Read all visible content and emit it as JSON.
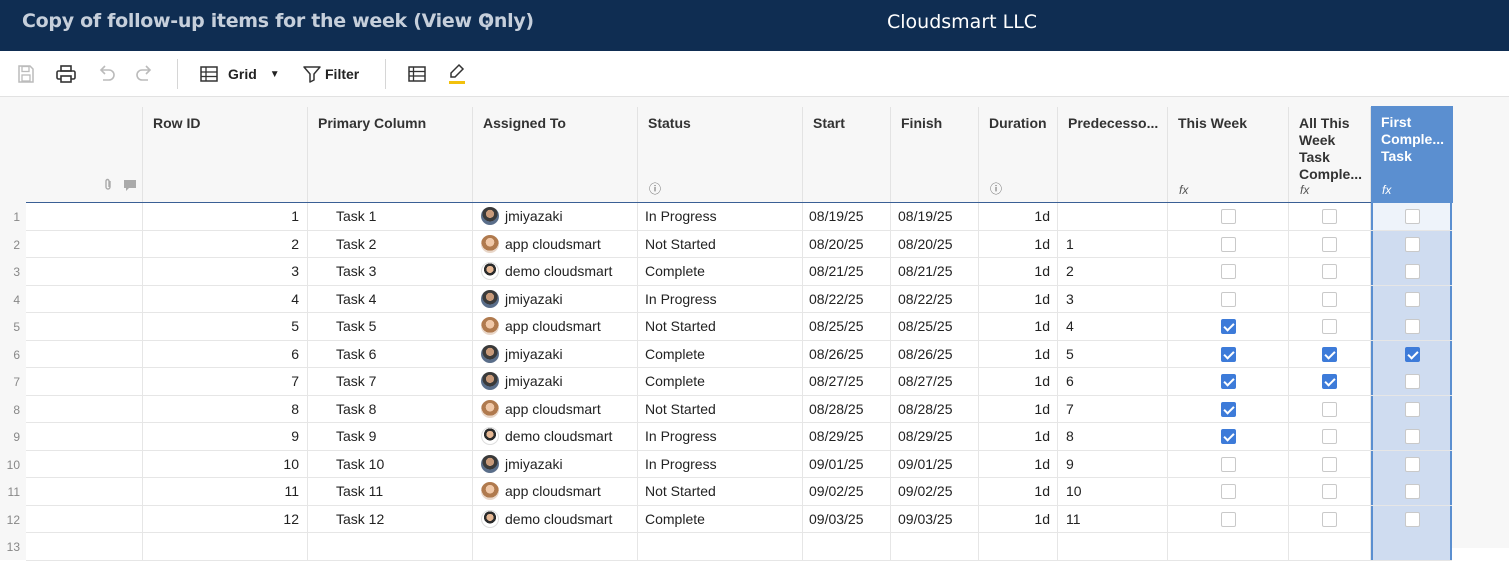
{
  "header": {
    "sheet_title": "Copy of follow-up items for the week (View Only)",
    "org_name": "Cloudsmart LLC"
  },
  "toolbar": {
    "view_label": "Grid",
    "filter_label": "Filter"
  },
  "columns": {
    "row_id": "Row ID",
    "primary": "Primary Column",
    "assigned": "Assigned To",
    "status": "Status",
    "start": "Start",
    "finish": "Finish",
    "duration": "Duration",
    "predecessors": "Predecesso...",
    "this_week": "This Week",
    "all_this_week": "All This\nWeek\nTask\nComple...",
    "first_complete": "First\nComple...\nTask",
    "fx": "fx"
  },
  "rows": [
    {
      "num": "1",
      "id": "1",
      "task": "Task 1",
      "assigned": "jmiyazaki",
      "av": "j",
      "status": "In Progress",
      "start": "08/19/25",
      "finish": "08/19/25",
      "dur": "1d",
      "pred": "",
      "tw": false,
      "atw": false,
      "fc": false
    },
    {
      "num": "2",
      "id": "2",
      "task": "Task 2",
      "assigned": "app cloudsmart",
      "av": "a",
      "status": "Not Started",
      "start": "08/20/25",
      "finish": "08/20/25",
      "dur": "1d",
      "pred": "1",
      "tw": false,
      "atw": false,
      "fc": false
    },
    {
      "num": "3",
      "id": "3",
      "task": "Task 3",
      "assigned": "demo cloudsmart",
      "av": "d",
      "status": "Complete",
      "start": "08/21/25",
      "finish": "08/21/25",
      "dur": "1d",
      "pred": "2",
      "tw": false,
      "atw": false,
      "fc": false
    },
    {
      "num": "4",
      "id": "4",
      "task": "Task 4",
      "assigned": "jmiyazaki",
      "av": "j",
      "status": "In Progress",
      "start": "08/22/25",
      "finish": "08/22/25",
      "dur": "1d",
      "pred": "3",
      "tw": false,
      "atw": false,
      "fc": false
    },
    {
      "num": "5",
      "id": "5",
      "task": "Task 5",
      "assigned": "app cloudsmart",
      "av": "a",
      "status": "Not Started",
      "start": "08/25/25",
      "finish": "08/25/25",
      "dur": "1d",
      "pred": "4",
      "tw": true,
      "atw": false,
      "fc": false
    },
    {
      "num": "6",
      "id": "6",
      "task": "Task 6",
      "assigned": "jmiyazaki",
      "av": "j",
      "status": "Complete",
      "start": "08/26/25",
      "finish": "08/26/25",
      "dur": "1d",
      "pred": "5",
      "tw": true,
      "atw": true,
      "fc": true
    },
    {
      "num": "7",
      "id": "7",
      "task": "Task 7",
      "assigned": "jmiyazaki",
      "av": "j",
      "status": "Complete",
      "start": "08/27/25",
      "finish": "08/27/25",
      "dur": "1d",
      "pred": "6",
      "tw": true,
      "atw": true,
      "fc": false
    },
    {
      "num": "8",
      "id": "8",
      "task": "Task 8",
      "assigned": "app cloudsmart",
      "av": "a",
      "status": "Not Started",
      "start": "08/28/25",
      "finish": "08/28/25",
      "dur": "1d",
      "pred": "7",
      "tw": true,
      "atw": false,
      "fc": false
    },
    {
      "num": "9",
      "id": "9",
      "task": "Task 9",
      "assigned": "demo cloudsmart",
      "av": "d",
      "status": "In Progress",
      "start": "08/29/25",
      "finish": "08/29/25",
      "dur": "1d",
      "pred": "8",
      "tw": true,
      "atw": false,
      "fc": false
    },
    {
      "num": "10",
      "id": "10",
      "task": "Task 10",
      "assigned": "jmiyazaki",
      "av": "j",
      "status": "In Progress",
      "start": "09/01/25",
      "finish": "09/01/25",
      "dur": "1d",
      "pred": "9",
      "tw": false,
      "atw": false,
      "fc": false
    },
    {
      "num": "11",
      "id": "11",
      "task": "Task 11",
      "assigned": "app cloudsmart",
      "av": "a",
      "status": "Not Started",
      "start": "09/02/25",
      "finish": "09/02/25",
      "dur": "1d",
      "pred": "10",
      "tw": false,
      "atw": false,
      "fc": false
    },
    {
      "num": "12",
      "id": "12",
      "task": "Task 12",
      "assigned": "demo cloudsmart",
      "av": "d",
      "status": "Complete",
      "start": "09/03/25",
      "finish": "09/03/25",
      "dur": "1d",
      "pred": "11",
      "tw": false,
      "atw": false,
      "fc": false
    },
    {
      "num": "13",
      "id": "",
      "task": "",
      "assigned": "",
      "av": "",
      "status": "",
      "start": "",
      "finish": "",
      "dur": "",
      "pred": "",
      "tw": null,
      "atw": null,
      "fc": null
    }
  ]
}
